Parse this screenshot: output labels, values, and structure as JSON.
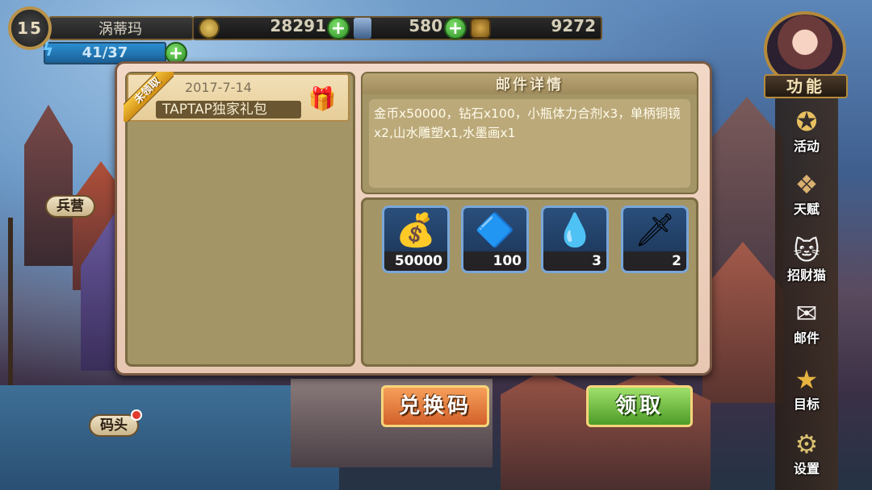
{
  "hud": {
    "level": "15",
    "player_name": "涡蒂玛",
    "gold": "28291",
    "diamonds": "580",
    "third_currency": "9272",
    "stamina": "41/37",
    "plus": "+"
  },
  "side_menu": {
    "header": "功能",
    "items": [
      {
        "label": "活动",
        "icon": "laurel-star-icon"
      },
      {
        "label": "天赋",
        "icon": "winged-chevron-icon"
      },
      {
        "label": "招财猫",
        "icon": "lucky-cat-icon"
      },
      {
        "label": "邮件",
        "icon": "envelope-icon"
      },
      {
        "label": "目标",
        "icon": "stars-target-icon"
      },
      {
        "label": "设置",
        "icon": "gear-icon"
      }
    ]
  },
  "map_tags": {
    "barracks": "兵营",
    "dock": "码头"
  },
  "mail": {
    "list": [
      {
        "status": "未领取",
        "date": "2017-7-14",
        "title": "TAPTAP独家礼包",
        "icon": "gift-box-icon"
      }
    ],
    "detail_header": "邮件详情",
    "detail_text": "金币x50000，钻石x100，小瓶体力合剂x3，单柄铜镜x2,山水雕塑x1,水墨画x1",
    "attachments": [
      {
        "name": "treasure-chest-icon",
        "glyph": "💰",
        "qty": "50000"
      },
      {
        "name": "crystal-emblem-icon",
        "glyph": "🔷",
        "qty": "100"
      },
      {
        "name": "potion-flask-icon",
        "glyph": "💧",
        "qty": "3"
      },
      {
        "name": "bronze-mirror-icon",
        "glyph": "🗡",
        "qty": "2"
      }
    ]
  },
  "buttons": {
    "redeem_code": "兑换码",
    "claim": "领取"
  },
  "colors": {
    "panel_bg": "#e7c7b2",
    "box_bg": "#a49566",
    "claim_green": "#4e9c28",
    "redeem_orange": "#d2602a",
    "unclaimed_ribbon": "#e2a52a"
  }
}
